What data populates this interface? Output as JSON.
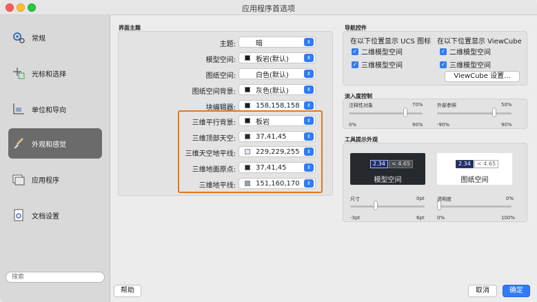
{
  "window": {
    "title": "应用程序首选项"
  },
  "sidebar": {
    "items": [
      {
        "label": "常规",
        "icon": "gears-icon"
      },
      {
        "label": "光标和选择",
        "icon": "cursor-icon"
      },
      {
        "label": "单位和导向",
        "icon": "units-icon"
      },
      {
        "label": "外观和感觉",
        "icon": "brush-icon",
        "active": true
      },
      {
        "label": "应用程序",
        "icon": "app-window-icon"
      },
      {
        "label": "文档设置",
        "icon": "document-icon"
      }
    ],
    "search_placeholder": "搜索"
  },
  "theme": {
    "section_title": "界面主题",
    "rows": [
      {
        "label": "主题:",
        "value": "暗",
        "swatch": null
      },
      {
        "label": "模型空间:",
        "value": "板岩(默认)",
        "swatch": "#1a1a1a"
      },
      {
        "label": "图纸空间:",
        "value": "白色(默认)",
        "swatch": null
      },
      {
        "label": "图纸空间背景:",
        "value": "灰色(默认)",
        "swatch": "#1a1a1a"
      },
      {
        "label": "块编辑器:",
        "value": "158,158,158",
        "swatch": "#1a1a1a"
      },
      {
        "label": "三维平行背景:",
        "value": "板岩",
        "swatch": "#1a1a1a"
      },
      {
        "label": "三维顶部天空:",
        "value": "37,41,45",
        "swatch": "#25292d"
      },
      {
        "label": "三维天空地平线:",
        "value": "229,229,255",
        "swatch": "#e5e5ff"
      },
      {
        "label": "三维地面原点:",
        "value": "37,41,45",
        "swatch": "#25292d"
      },
      {
        "label": "三维地平线:",
        "value": "151,160,170",
        "swatch": "#97a0aa"
      }
    ]
  },
  "nav_controls": {
    "section_title": "导航控件",
    "ucs_heading": "在以下位置显示 UCS 图标",
    "viewcube_heading": "在以下位置显示 ViewCube",
    "ucs_2d": "二维模型空间",
    "ucs_3d": "三维模型空间",
    "vc_2d": "二维模型空间",
    "vc_3d": "三维模型空间",
    "viewcube_settings": "ViewCube 设置..."
  },
  "fade": {
    "section_title": "淡入度控制",
    "annot_label": "注释性对象",
    "annot_value": "70%",
    "annot_min": "0%",
    "annot_max": "90%",
    "annot_level": 0.78,
    "xref_label": "外部参照",
    "xref_value": "50%",
    "xref_min": "-90%",
    "xref_max": "90%",
    "xref_level": 0.78
  },
  "tooltip": {
    "section_title": "工具提示外观",
    "model_label": "模型空间",
    "paper_label": "图纸空间",
    "sample_value": "2.34",
    "sample_cmp": "< 4.65",
    "size_label": "尺寸",
    "size_value": "0pt",
    "size_min": "-3pt",
    "size_max": "6pt",
    "size_level": 0.33,
    "opacity_label": "透明度",
    "opacity_value": "0%",
    "opacity_min": "0%",
    "opacity_max": "100%",
    "opacity_level": 0.0
  },
  "footer": {
    "help": "帮助",
    "cancel": "取消",
    "ok": "确定"
  },
  "colors": {
    "accent": "#2f7cf6",
    "highlight": "#e2781c",
    "sidebar_active": "#6b6b6b"
  }
}
